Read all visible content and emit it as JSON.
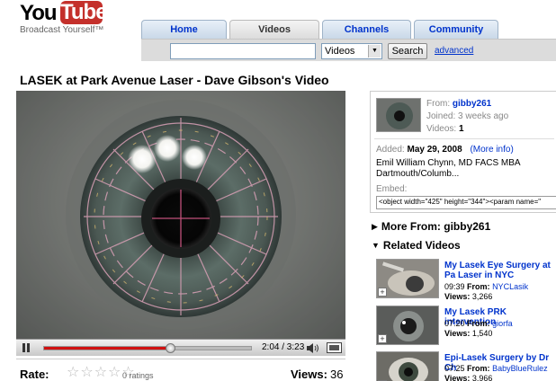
{
  "header": {
    "logo_you": "You",
    "logo_tube": "Tube",
    "tagline": "Broadcast Yourself™",
    "nav": [
      "Home",
      "Videos",
      "Channels",
      "Community"
    ],
    "search": {
      "value": "",
      "scope": "Videos",
      "button": "Search",
      "advanced": "advanced"
    }
  },
  "video": {
    "title": "LASEK at Park Avenue Laser - Dave Gibson's Video",
    "time": "2:04 / 3:23",
    "progress": 0.61
  },
  "rating": {
    "label": "Rate:",
    "count": "0 ratings",
    "views_label": "Views:",
    "views": "36"
  },
  "info": {
    "from_label": "From:",
    "from": "gibby261",
    "joined": "Joined: 3 weeks ago",
    "videos_label": "Videos:",
    "videos": "1",
    "added_label": "Added:",
    "added": "May 29, 2008",
    "more_info": "(More info)",
    "description_1": "Emil William Chynn, MD FACS MBA",
    "description_2": "Dartmouth/Columb...",
    "embed_label": "Embed:",
    "embed_code": "<object width=\"425\" height=\"344\"><param name=\""
  },
  "sections": {
    "more_from": "More From: gibby261",
    "related": "Related Videos"
  },
  "related": [
    {
      "title": "My Lasek Eye Surgery at Pa Laser in NYC",
      "time": "09:39",
      "from": "NYCLasik",
      "views": "3,266"
    },
    {
      "title": "My Lasek PRK intervention",
      "time": "07:20",
      "from": "giorfa",
      "views": "1,540"
    },
    {
      "title": "Epi-Lasek Surgery by Dr Ch",
      "time": "07:25",
      "from": "BabyBlueRulez",
      "views": "3,966"
    }
  ],
  "labels": {
    "from": "From:",
    "views": "Views:"
  },
  "colors": {
    "brand_red": "#c4302b",
    "link_blue": "#0033cc",
    "progress_red": "#d01010"
  }
}
